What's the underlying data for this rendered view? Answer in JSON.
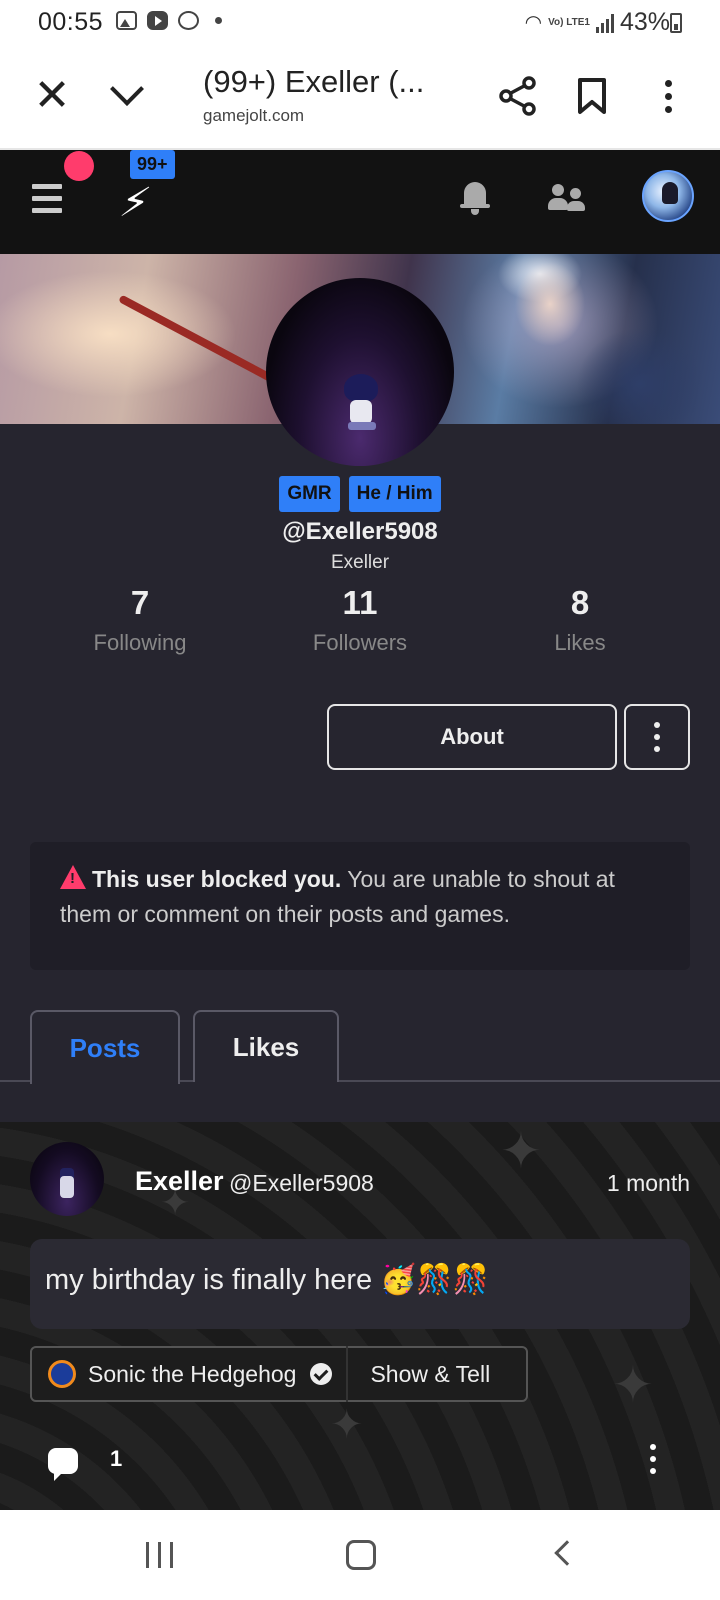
{
  "status_bar": {
    "time": "00:55",
    "lte_label": "Vo) LTE1",
    "battery": "43%"
  },
  "browser": {
    "tab_title": "(99+) Exeller (...",
    "url": "gamejolt.com",
    "icons": [
      "close-icon",
      "chevron-down-icon",
      "share-icon",
      "bookmark-icon",
      "more-vertical-icon"
    ]
  },
  "site_header": {
    "notification_badge": "99+",
    "icons": [
      "menu-icon",
      "gamejolt-logo-icon",
      "bell-icon",
      "friends-icon",
      "avatar"
    ]
  },
  "profile": {
    "tags": [
      "GMR",
      "He / Him"
    ],
    "handle": "@Exeller5908",
    "display_name": "Exeller",
    "stats": [
      {
        "value": "7",
        "label": "Following"
      },
      {
        "value": "11",
        "label": "Followers"
      },
      {
        "value": "8",
        "label": "Likes"
      }
    ],
    "about_label": "About",
    "blocked_notice": {
      "bold": "This user blocked you.",
      "text": " You are unable to shout at them or comment on their posts and games."
    },
    "tabs": [
      "Posts",
      "Likes"
    ],
    "active_tab": "Posts"
  },
  "post": {
    "author": "Exeller",
    "handle": "@Exeller5908",
    "time": "1 month",
    "body": "my birthday is finally here 🥳🎊🎊",
    "game": "Sonic the Hedgehog",
    "category": "Show & Tell",
    "comment_count": "1"
  },
  "colors": {
    "accent": "#2f7ff8",
    "alert": "#ff3c6c",
    "page_bg": "#26252f",
    "header_bg": "#121212"
  }
}
